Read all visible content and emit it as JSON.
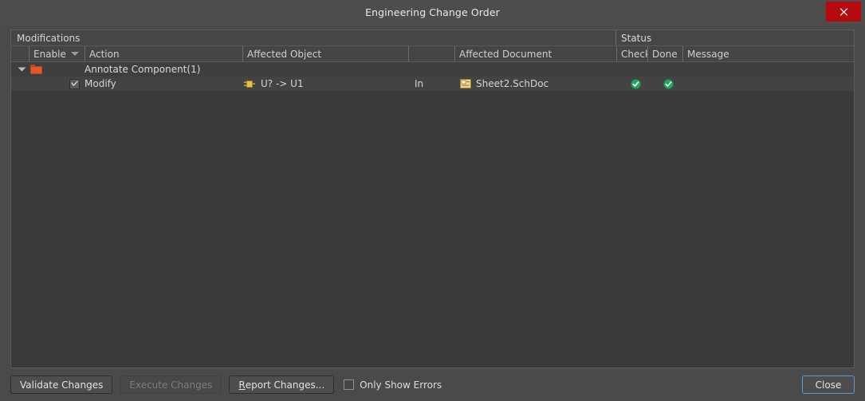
{
  "window": {
    "title": "Engineering Change Order",
    "close_icon": "close-x-icon"
  },
  "panel": {
    "caption": "Modifications",
    "group_header": "Status"
  },
  "columns": [
    {
      "id": "enable",
      "label": "Enable",
      "sort_icon": "sort-descending-icon"
    },
    {
      "id": "action",
      "label": "Action"
    },
    {
      "id": "affected_object",
      "label": "Affected Object"
    },
    {
      "id": "relation",
      "label": ""
    },
    {
      "id": "affected_document",
      "label": "Affected Document"
    },
    {
      "id": "check",
      "label": "Check"
    },
    {
      "id": "done",
      "label": "Done"
    },
    {
      "id": "message",
      "label": "Message"
    }
  ],
  "rows": [
    {
      "type": "group",
      "expand_icon": "expand-triangle-icon",
      "folder_icon": "folder-icon",
      "action": "Annotate Component(1)",
      "affected_object": "",
      "relation": "",
      "affected_document": "",
      "check": "",
      "done": "",
      "message": ""
    },
    {
      "type": "item",
      "enabled": true,
      "enable_icon": "checkbox-checked-icon",
      "action": "Modify",
      "object_icon": "component-part-icon",
      "affected_object": "U? -> U1",
      "relation": "In",
      "document_icon": "schematic-document-icon",
      "affected_document": "Sheet2.SchDoc",
      "check_icon": "status-ok-icon",
      "done_icon": "status-ok-icon",
      "message": ""
    }
  ],
  "footer": {
    "validate_label": "Validate Changes",
    "execute_label": "Execute Changes",
    "report_label_mnemonic": "R",
    "report_label_rest": "eport Changes...",
    "only_show_errors_label": "Only Show Errors",
    "only_show_errors_checked": false,
    "close_label": "Close"
  },
  "colors": {
    "accent_focus": "#5b9bd5",
    "close_red": "#b40a10",
    "status_green": "#2aa360",
    "folder_orange": "#e0572c",
    "part_yellow": "#e8c24a"
  }
}
